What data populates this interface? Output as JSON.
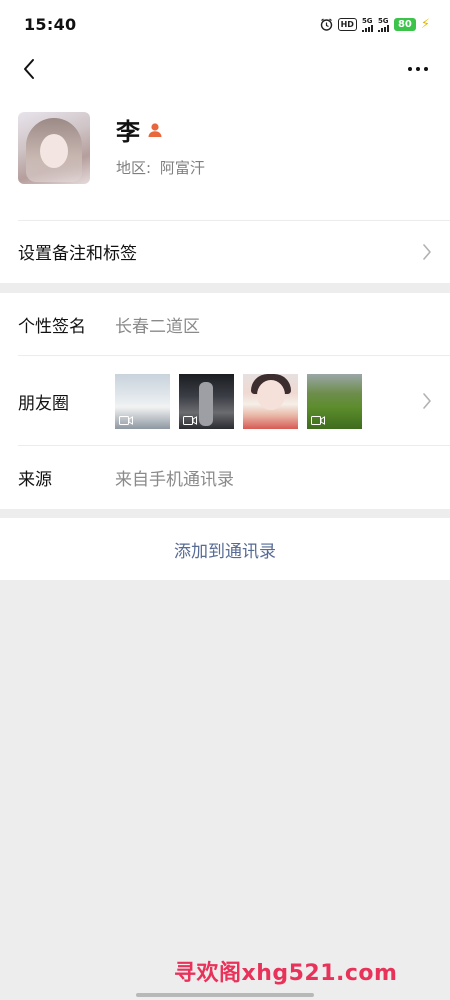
{
  "status_bar": {
    "time": "15:40",
    "hd_label": "HD",
    "signal1_label": "5G",
    "signal2_label": "5G",
    "battery_level": "80"
  },
  "profile": {
    "name": "李",
    "region_label": "地区:",
    "region_value": "阿富汗",
    "gender_icon": "female-person-icon",
    "accent_color": "#e8673c"
  },
  "rows": {
    "remark": {
      "label": "设置备注和标签"
    },
    "signature": {
      "label": "个性签名",
      "value": "长春二道区"
    },
    "moments": {
      "label": "朋友圈"
    },
    "source": {
      "label": "来源",
      "value": "来自手机通讯录"
    }
  },
  "actions": {
    "add_contact_label": "添加到通讯录",
    "link_color": "#576b95"
  },
  "watermark": "寻欢阁xhg521.com"
}
